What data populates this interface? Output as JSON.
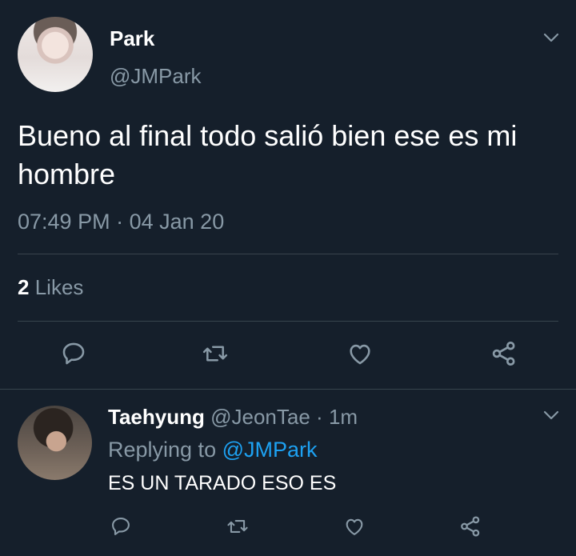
{
  "main_tweet": {
    "author_name": "Park",
    "author_handle": "@JMPark",
    "text": "Bueno al final todo salió bien ese es mi hombre",
    "time": "07:49 PM",
    "separator": "·",
    "date": "04 Jan 20",
    "likes_count": "2",
    "likes_label": "Likes"
  },
  "reply_tweet": {
    "author_name": "Taehyung",
    "author_handle": "@JeonTae",
    "separator": "·",
    "age": "1m",
    "replying_prefix": "Replying to",
    "replying_to": "@JMPark",
    "text": "ES UN TARADO ESO ES"
  },
  "icons": [
    "chevron-down-icon",
    "reply-icon",
    "retweet-icon",
    "like-icon",
    "share-icon"
  ],
  "colors": {
    "background": "#151f2b",
    "secondary_text": "#8899a6",
    "divider": "#38444d",
    "link": "#1da1f2"
  }
}
